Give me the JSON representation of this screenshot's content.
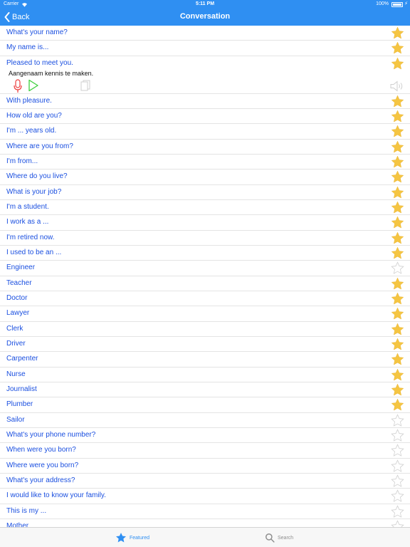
{
  "status_bar": {
    "carrier": "Carrier",
    "time": "5:11 PM",
    "battery": "100%"
  },
  "nav": {
    "back_label": "Back",
    "title": "Conversation"
  },
  "colors": {
    "accent": "#2f8ff2",
    "phrase_text": "#1a4fe0",
    "star_filled": "#f5c542",
    "star_empty": "#d0d0d0",
    "mic": "#ec3b3b",
    "play": "#3ccf3c"
  },
  "expanded": {
    "index": 2,
    "translation": "Aangenaam kennis te maken.",
    "icons": [
      "microphone-icon",
      "play-icon",
      "copy-icon",
      "speaker-icon"
    ]
  },
  "phrases": [
    {
      "text": "What's your name?",
      "starred": true
    },
    {
      "text": "My name is...",
      "starred": true
    },
    {
      "text": "Pleased to meet you.",
      "starred": true
    },
    {
      "text": "With pleasure.",
      "starred": true
    },
    {
      "text": "How old are you?",
      "starred": true
    },
    {
      "text": "I'm ... years old.",
      "starred": true
    },
    {
      "text": "Where are you from?",
      "starred": true
    },
    {
      "text": "I'm from...",
      "starred": true
    },
    {
      "text": "Where do you live?",
      "starred": true
    },
    {
      "text": "What is your job?",
      "starred": true
    },
    {
      "text": "I'm a student.",
      "starred": true
    },
    {
      "text": "I work as a ...",
      "starred": true
    },
    {
      "text": "I'm retired now.",
      "starred": true
    },
    {
      "text": "I used to be an ...",
      "starred": true
    },
    {
      "text": "Engineer",
      "starred": false
    },
    {
      "text": "Teacher",
      "starred": true
    },
    {
      "text": "Doctor",
      "starred": true
    },
    {
      "text": "Lawyer",
      "starred": true
    },
    {
      "text": "Clerk",
      "starred": true
    },
    {
      "text": "Driver",
      "starred": true
    },
    {
      "text": "Carpenter",
      "starred": true
    },
    {
      "text": "Nurse",
      "starred": true
    },
    {
      "text": "Journalist",
      "starred": true
    },
    {
      "text": "Plumber",
      "starred": true
    },
    {
      "text": "Sailor",
      "starred": false
    },
    {
      "text": "What's your phone number?",
      "starred": false
    },
    {
      "text": "When were you born?",
      "starred": false
    },
    {
      "text": "Where were you born?",
      "starred": false
    },
    {
      "text": "What's your address?",
      "starred": false
    },
    {
      "text": "I would like to know your family.",
      "starred": false
    },
    {
      "text": "This is my ...",
      "starred": false
    },
    {
      "text": "Mother",
      "starred": false
    }
  ],
  "tabs": [
    {
      "label": "Featured",
      "icon": "star-icon",
      "active": true
    },
    {
      "label": "Search",
      "icon": "search-icon",
      "active": false
    }
  ]
}
